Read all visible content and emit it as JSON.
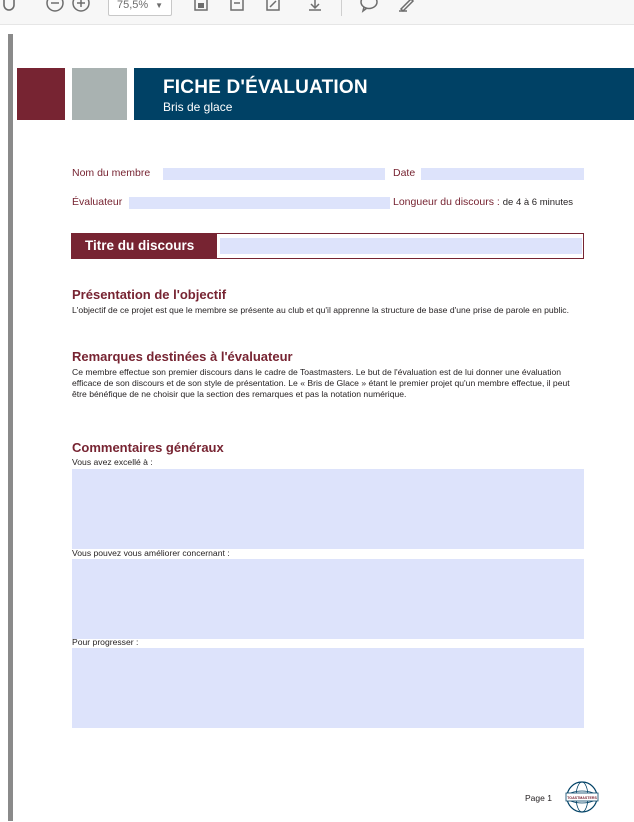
{
  "toolbar": {
    "zoom_value": "75,5%",
    "icons": [
      "hand-icon",
      "zoom-out-icon",
      "zoom-in-icon",
      "fit-page-icon",
      "fit-width-icon",
      "rotate-icon",
      "download-icon",
      "comment-icon",
      "draw-icon"
    ]
  },
  "header": {
    "title": "FICHE D'ÉVALUATION",
    "subtitle": "Bris de glace"
  },
  "form": {
    "member_label": "Nom du membre",
    "date_label": "Date",
    "evaluator_label": "Évaluateur",
    "length_label": "Longueur du discours :",
    "length_value": "de 4 à 6 minutes",
    "speech_title_label": "Titre du discours"
  },
  "sections": {
    "purpose_heading": "Présentation de l'objectif",
    "purpose_text": "L'objectif de ce projet est que le membre se présente au club et qu'il apprenne la structure de base d'une prise de parole en public.",
    "notes_heading": "Remarques destinées à l'évaluateur",
    "notes_text": "Ce membre effectue son premier discours dans le cadre de Toastmasters. Le but de l'évaluation est de lui donner une évaluation efficace de son discours et de son style de présentation. Le « Bris de Glace » étant le premier projet qu'un membre effectue, il peut être bénéfique de ne choisir que la section des remarques et pas la notation numérique.",
    "comments_heading": "Commentaires généraux",
    "excelled_label": "Vous avez excellé à :",
    "improve_label": "Vous pouvez vous améliorer concernant :",
    "progress_label": "Pour progresser :"
  },
  "footer": {
    "page_label": "Page 1",
    "logo_text": "TOASTMASTERS"
  },
  "colors": {
    "brand_red": "#772432",
    "brand_blue": "#004165",
    "brand_gray": "#a9b2b1",
    "field_fill": "#dde3fb"
  }
}
